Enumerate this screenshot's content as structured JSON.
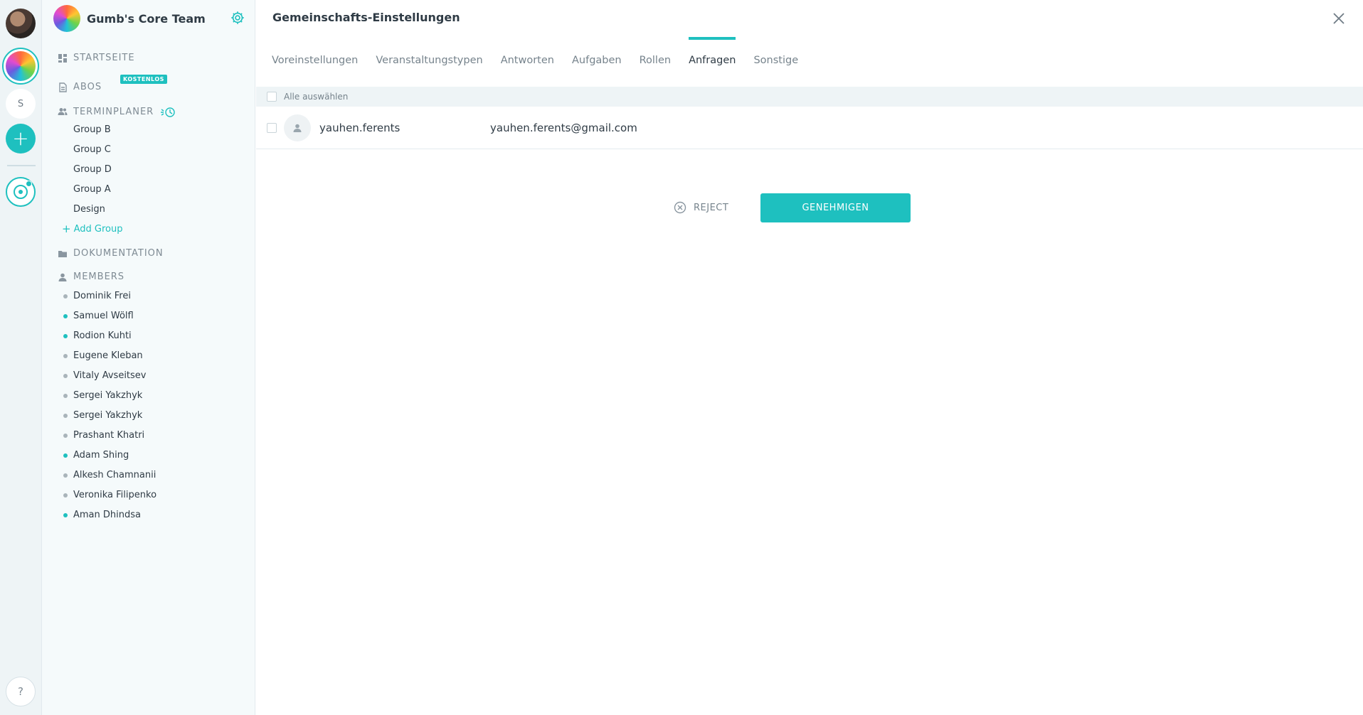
{
  "team": {
    "name": "Gumb's Core Team"
  },
  "rail": {
    "server_letter": "S",
    "add_label": "+",
    "help_label": "?"
  },
  "sidebar": {
    "home_label": "STARTSEITE",
    "subscriptions_label": "ABOS",
    "subscriptions_badge": "KOSTENLOS",
    "scheduler_label": "TERMINPLANER",
    "groups": [
      "Group B",
      "Group C",
      "Group D",
      "Group A",
      "Design"
    ],
    "add_group_label": "Add Group",
    "docs_label": "DOKUMENTATION",
    "members_label": "MEMBERS",
    "members": [
      {
        "name": "Dominik Frei",
        "online": false
      },
      {
        "name": "Samuel Wölfl",
        "online": true
      },
      {
        "name": "Rodion Kuhti",
        "online": true
      },
      {
        "name": "Eugene Kleban",
        "online": false
      },
      {
        "name": "Vitaly Avseitsev",
        "online": false
      },
      {
        "name": "Sergei Yakzhyk",
        "online": false
      },
      {
        "name": "Sergei Yakzhyk",
        "online": false
      },
      {
        "name": "Prashant Khatri",
        "online": false
      },
      {
        "name": "Adam Shing",
        "online": true
      },
      {
        "name": "Alkesh Chamnanii",
        "online": false
      },
      {
        "name": "Veronika Filipenko",
        "online": false
      },
      {
        "name": "Aman Dhindsa",
        "online": true
      }
    ]
  },
  "main": {
    "title": "Gemeinschafts-Einstellungen",
    "tabs": [
      {
        "label": "Voreinstellungen",
        "active": false
      },
      {
        "label": "Veranstaltungstypen",
        "active": false
      },
      {
        "label": "Antworten",
        "active": false
      },
      {
        "label": "Aufgaben",
        "active": false
      },
      {
        "label": "Rollen",
        "active": false
      },
      {
        "label": "Anfragen",
        "active": true
      },
      {
        "label": "Sonstige",
        "active": false
      }
    ],
    "select_all_label": "Alle auswählen",
    "requests": [
      {
        "name": "yauhen.ferents",
        "email": "yauhen.ferents@gmail.com"
      }
    ],
    "reject_label": "REJECT",
    "approve_label": "GENEHMIGEN"
  },
  "colors": {
    "accent": "#1ec0bf",
    "text": "#2f3b45",
    "muted": "#76838c",
    "online": "#1ec0bf",
    "offline": "#a9b4ba"
  }
}
